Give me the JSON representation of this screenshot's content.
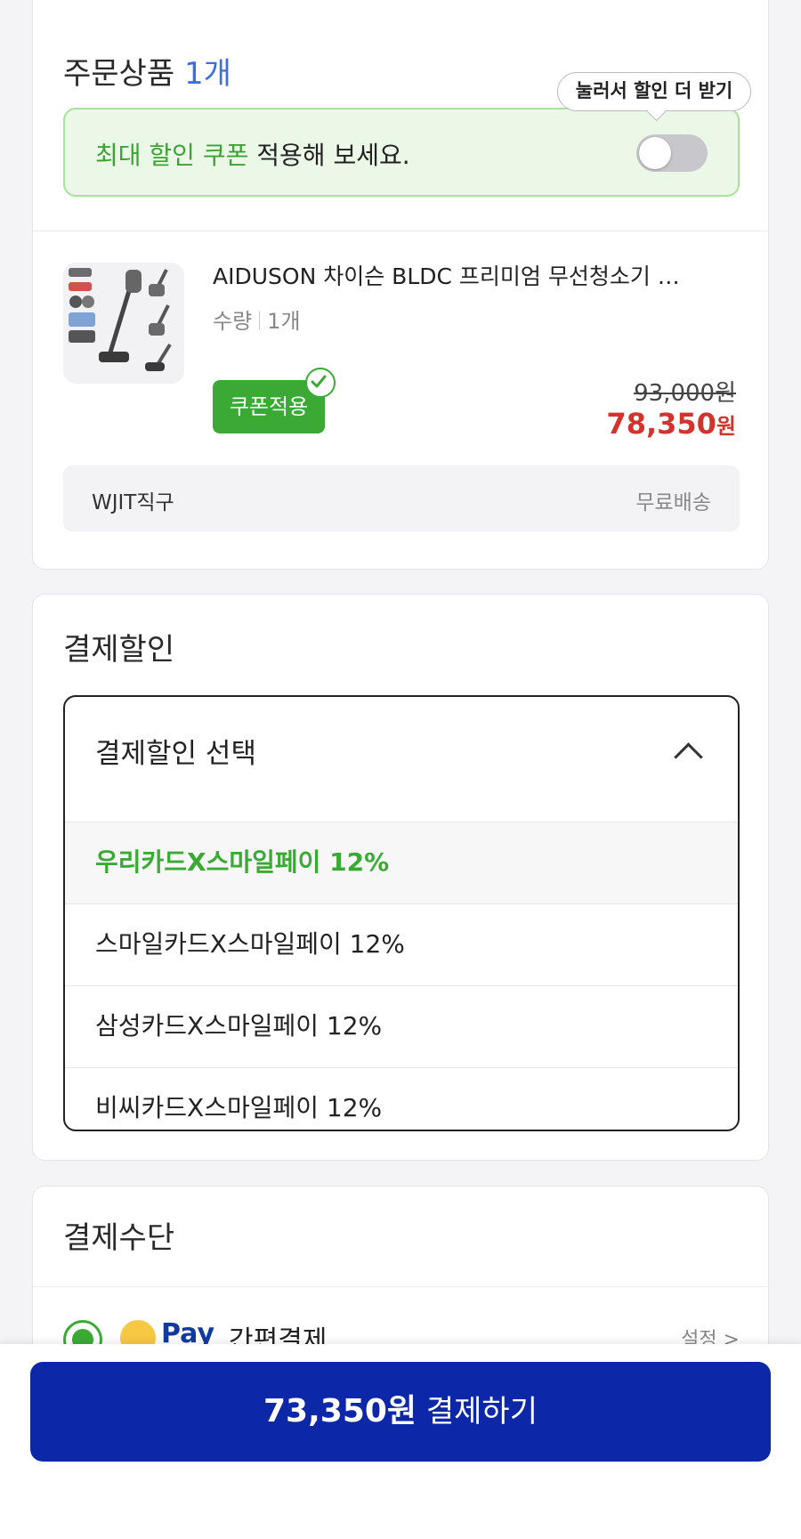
{
  "order": {
    "title": "주문상품",
    "count": "1개",
    "tooltip": "눌러서 할인 더 받기",
    "coupon_banner_highlight": "최대 할인 쿠폰",
    "coupon_banner_rest": "적용해 보세요.",
    "coupon_toggle_on": false,
    "product": {
      "name": "AIDUSON 차이슨 BLDC 프리미엄 무선청소기 …",
      "qty_label": "수량",
      "qty_value": "1개",
      "coupon_badge": "쿠폰적용",
      "original_price": "93,000원",
      "sale_price_num": "78,350",
      "sale_price_unit": "원"
    },
    "seller": "WJIT직구",
    "shipping": "무료배송"
  },
  "discount": {
    "title": "결제할인",
    "dropdown_label": "결제할인 선택",
    "options": [
      "우리카드X스마일페이 12%",
      "스마일카드X스마일페이 12%",
      "삼성카드X스마일페이 12%",
      "비씨카드X스마일페이 12%"
    ]
  },
  "payment": {
    "title": "결제수단",
    "method_logo": "Pay",
    "method_name": "간편결제",
    "setting": "설정 >"
  },
  "checkout": {
    "amount": "73,350원",
    "label": "결제하기"
  },
  "colors": {
    "accent_green": "#3aaa35",
    "price_red": "#d0342c",
    "button_blue": "#0c27a8",
    "count_blue": "#3b6fe0"
  }
}
